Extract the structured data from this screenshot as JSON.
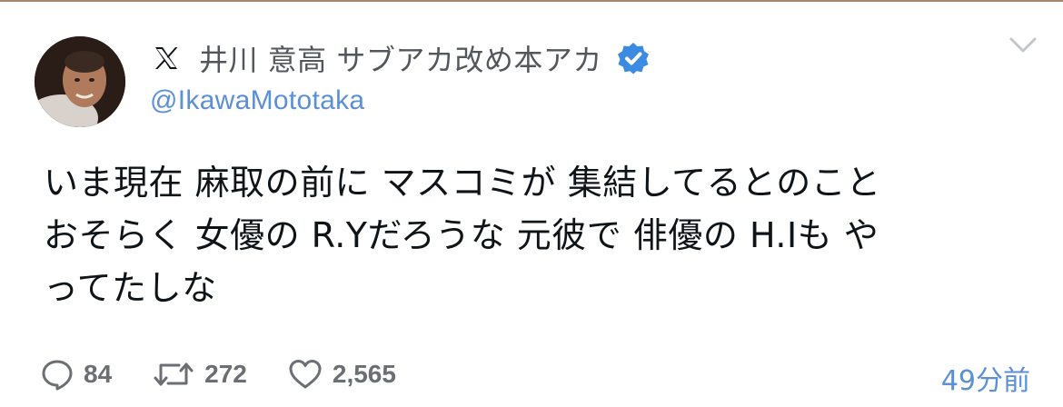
{
  "tweet": {
    "display_name": "井川 意高 サブアカ改め本アカ",
    "handle": "@IkawaMototaka",
    "text": "いま現在 麻取の前に マスコミが 集結してるとのこと\nおそらく 女優の R.Yだろうな 元彼で 俳優の H.Iも や\nってたしな",
    "timestamp": "49分前",
    "metrics": {
      "replies": "84",
      "retweets": "272",
      "likes": "2,565"
    }
  },
  "icons": {
    "brand": "x-logo-icon",
    "verified": "verified-badge-icon",
    "menu": "chevron-down-icon",
    "reply": "reply-icon",
    "retweet": "retweet-icon",
    "like": "heart-icon"
  },
  "colors": {
    "link": "#5b8fd6",
    "verified": "#3b8be3",
    "muted": "#6b6f74",
    "text": "#0f1419"
  }
}
